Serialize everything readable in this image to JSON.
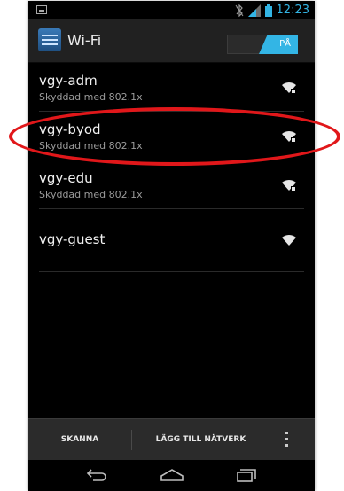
{
  "status_bar": {
    "time": "12:23",
    "icons": [
      "notification-icon",
      "bluetooth-off-icon",
      "signal-icon",
      "battery-icon"
    ]
  },
  "action_bar": {
    "title": "Wi-Fi",
    "app_icon": "wifi-settings-icon",
    "toggle_label": "PÅ"
  },
  "networks": [
    {
      "ssid": "vgy-adm",
      "security": "Skyddad med 802.1x",
      "icon": "wifi-secured-icon"
    },
    {
      "ssid": "vgy-byod",
      "security": "Skyddad med 802.1x",
      "icon": "wifi-secured-icon"
    },
    {
      "ssid": "vgy-edu",
      "security": "Skyddad med 802.1x",
      "icon": "wifi-secured-icon"
    },
    {
      "ssid": "vgy-guest",
      "security": "",
      "icon": "wifi-open-icon"
    }
  ],
  "bottom_bar": {
    "scan_label": "SKANNA",
    "add_network_label": "LÄGG TILL NÄTVERK",
    "overflow_icon": "overflow-menu-icon"
  },
  "nav_bar": {
    "icons": [
      "back-icon",
      "home-icon",
      "recent-apps-icon"
    ]
  },
  "colors": {
    "accent": "#33b5e5",
    "highlight_annotation": "#e1171a",
    "background": "#000000",
    "action_bar": "#212121"
  }
}
